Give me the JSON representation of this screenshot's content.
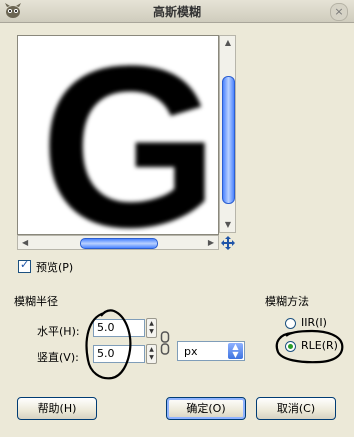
{
  "window": {
    "title": "高斯模糊",
    "close_glyph": "×"
  },
  "preview_area": {
    "letter": "G"
  },
  "preview_checkbox": {
    "label": "预览(P)",
    "checked": true
  },
  "blur_radius": {
    "title": "模糊半径",
    "horizontal": {
      "label": "水平(H):",
      "value": "5.0"
    },
    "vertical": {
      "label": "竖直(V):",
      "value": "5.0"
    },
    "unit": "px"
  },
  "blur_method": {
    "title": "模糊方法",
    "options": [
      {
        "label": "IIR(I)",
        "selected": false
      },
      {
        "label": "RLE(R)",
        "selected": true
      }
    ]
  },
  "buttons": {
    "help": "帮助(H)",
    "ok": "确定(O)",
    "cancel": "取消(C)"
  },
  "colors": {
    "accent": "#4c84ff",
    "annotation": "#000000",
    "background": "#ece9d8"
  }
}
